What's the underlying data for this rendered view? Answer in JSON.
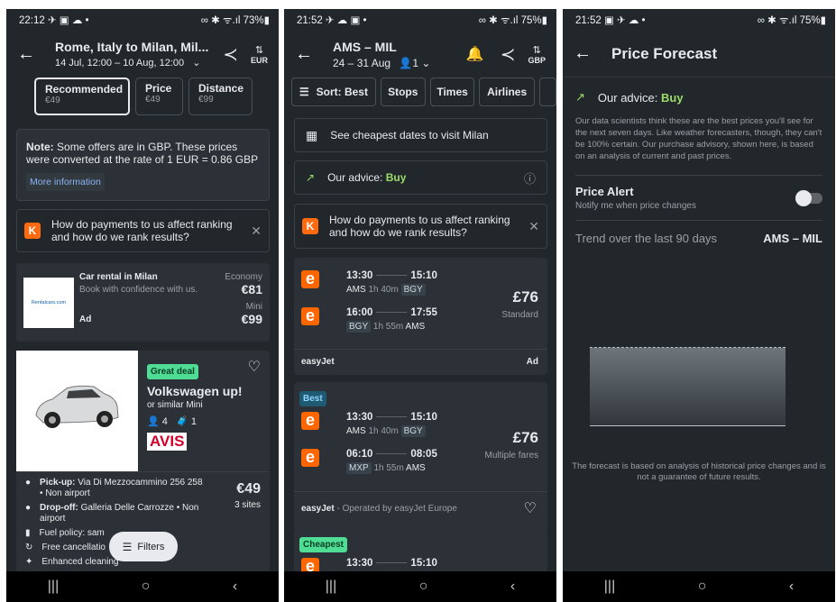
{
  "screen1": {
    "status_time": "22:12 ✈ ▣ ☁ •",
    "status_right": "∞ ✱ ᯤ.ıl 73%▮",
    "route_title": "Rome, Italy to Milan, Mil...",
    "dates": "14 Jul, 12:00 – 10 Aug, 12:00",
    "currency": "EUR",
    "sort_tabs": [
      {
        "label": "Recommended",
        "price": "€49"
      },
      {
        "label": "Price",
        "price": "€49"
      },
      {
        "label": "Distance",
        "price": "€99"
      }
    ],
    "note_bold": "Note:",
    "note_text": "Some offers are in GBP. These prices were converted at the rate of 1 EUR = 0.86 GBP",
    "more_info": "More information",
    "payments_text": "How do payments to us affect ranking and how do we rank results?",
    "k_letter": "K",
    "ad": {
      "logo_text": "Rentalcars.com",
      "title": "Car rental in Milan",
      "subtitle": "Book with confidence with us.",
      "ad_label": "Ad",
      "class1": "Economy",
      "price1": "€81",
      "class2": "Mini",
      "price2": "€99"
    },
    "car": {
      "deal": "Great deal",
      "name": "Volkswagen up!",
      "similar": "or similar Mini",
      "seats": "4",
      "bags": "1",
      "brand": "AVIS",
      "pickup_label": "Pick-up:",
      "pickup": "Via Di Mezzocammino 256 258 • Non airport",
      "dropoff_label": "Drop-off:",
      "dropoff": "Galleria Delle Carrozze • Non airport",
      "price": "€49",
      "sites": "3 sites",
      "fuel": "Fuel policy: sam",
      "cancel": "Free cancellatio",
      "cleaning": "Enhanced cleaning",
      "filters": "Filters"
    }
  },
  "screen2": {
    "status_time": "21:52 ✈ ☁ ▣ •",
    "status_right": "∞ ✱ ᯤ.ıl 75%▮",
    "route_title": "AMS – MIL",
    "dates": "24 – 31 Aug",
    "travellers": "1",
    "currency": "GBP",
    "chips": [
      "Sort: Best",
      "Stops",
      "Times",
      "Airlines"
    ],
    "cheapest_dates": "See cheapest dates to visit Milan",
    "advice_label": "Our advice:",
    "advice_value": "Buy",
    "payments_text": "How do payments to us affect ranking and how do we rank results?",
    "k_letter": "K",
    "result1": {
      "legs": [
        {
          "dep": "13:30",
          "arr": "15:10",
          "from": "AMS",
          "dur": "1h 40m",
          "to": "BGY"
        },
        {
          "dep": "16:00",
          "arr": "17:55",
          "from": "BGY",
          "dur": "1h 55m",
          "to": "AMS"
        }
      ],
      "price": "£76",
      "fare": "Standard",
      "airline": "easyJet",
      "ad": "Ad"
    },
    "result2": {
      "badge": "Best",
      "legs": [
        {
          "dep": "13:30",
          "arr": "15:10",
          "from": "AMS",
          "dur": "1h 40m",
          "to": "BGY"
        },
        {
          "dep": "06:10",
          "arr": "08:05",
          "from": "MXP",
          "dur": "1h 55m",
          "to": "AMS"
        }
      ],
      "price": "£76",
      "fare": "Multiple fares",
      "airline": "easyJet",
      "operated": " - Operated by easyJet Europe"
    },
    "result3": {
      "badge": "Cheapest",
      "dep": "13:30",
      "arr": "15:10"
    }
  },
  "screen3": {
    "status_time": "21:52 ▣ ✈ ☁ •",
    "status_right": "∞ ✱ ᯤ.ıl 75%▮",
    "title": "Price Forecast",
    "advice_label": "Our advice:",
    "advice_value": "Buy",
    "advice_text": "Our data scientists think these are the best prices you'll see for the next seven days. Like weather forecasters, though, they can't be 100% certain. Our purchase advisory, shown here, is based on an analysis of current and past prices.",
    "alert_title": "Price Alert",
    "alert_sub": "Notify me when price changes",
    "trend_label": "Trend over the last 90 days",
    "trend_route": "AMS – MIL",
    "disclaimer": "The forecast is based on analysis of historical price changes and is not a guarantee of future results."
  },
  "nav": {
    "recent": "|||",
    "home": "○",
    "back": "‹"
  },
  "colors": {
    "bg": "#22272c",
    "card": "#2b3136",
    "green": "#9cdc6b",
    "deal_bg": "#4fdd95",
    "kayak_orange": "#ff690f",
    "easyjet_orange": "#ff6600",
    "avis_red": "#d4002a"
  }
}
